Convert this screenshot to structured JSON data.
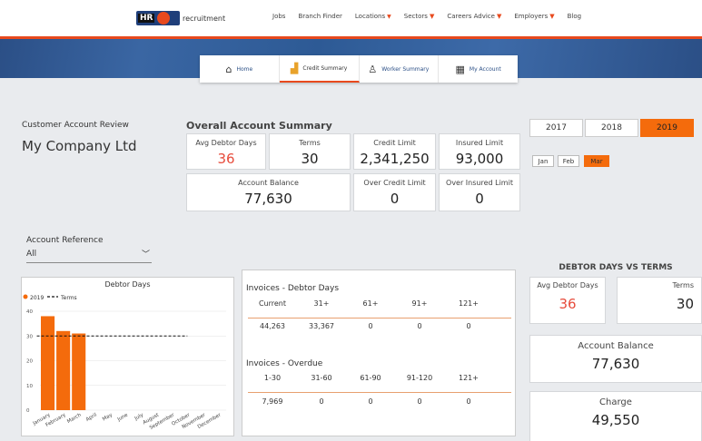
{
  "nav": {
    "logo_hr": "HR",
    "logo_text": "recruitment",
    "links": [
      {
        "label": "Jobs",
        "dropdown": false
      },
      {
        "label": "Branch Finder",
        "dropdown": false
      },
      {
        "label": "Locations",
        "dropdown": true
      },
      {
        "label": "Sectors",
        "dropdown": true
      },
      {
        "label": "Careers Advice",
        "dropdown": true
      },
      {
        "label": "Employers",
        "dropdown": true
      },
      {
        "label": "Blog",
        "dropdown": false
      }
    ],
    "dropdown_glyph": "▼"
  },
  "tabs": [
    {
      "label": "Home",
      "icon": "home-icon",
      "glyph": "⌂"
    },
    {
      "label": "Credit Summary",
      "icon": "chart-icon",
      "glyph": "▟"
    },
    {
      "label": "Worker Summary",
      "icon": "person-icon",
      "glyph": "♙"
    },
    {
      "label": "My Account",
      "icon": "calculator-icon",
      "glyph": "▦"
    }
  ],
  "customer": {
    "review_label": "Customer Account Review",
    "company": "My Company Ltd"
  },
  "summary": {
    "title": "Overall Account Summary",
    "avg_debtor_days": {
      "label": "Avg Debtor Days",
      "value": "36"
    },
    "terms": {
      "label": "Terms",
      "value": "30"
    },
    "credit_limit": {
      "label": "Credit Limit",
      "value": "2,341,250"
    },
    "insured_limit": {
      "label": "Insured Limit",
      "value": "93,000"
    },
    "account_balance": {
      "label": "Account Balance",
      "value": "77,630"
    },
    "over_credit_limit": {
      "label": "Over Credit Limit",
      "value": "0"
    },
    "over_insured_limit": {
      "label": "Over Insured Limit",
      "value": "0"
    }
  },
  "years": [
    "2017",
    "2018",
    "2019"
  ],
  "months": [
    "Jan",
    "Feb",
    "Mar"
  ],
  "account_reference": {
    "label": "Account Reference",
    "value": "All",
    "chevron": "﹀"
  },
  "debtor_chart_title": "Debtor Days",
  "debtor_vs_terms": {
    "title": "DEBTOR DAYS VS TERMS",
    "avg_label": "Avg Debtor Days",
    "avg_value": "36",
    "terms_label": "Terms",
    "terms_value": "30",
    "balance_label": "Account Balance",
    "balance_value": "77,630",
    "charge_label": "Charge",
    "charge_value": "49,550"
  },
  "invoices_debtor": {
    "title": "Invoices - Debtor Days",
    "headers": [
      "Current",
      "31+",
      "61+",
      "91+",
      "121+"
    ],
    "values": [
      "44,263",
      "33,367",
      "0",
      "0",
      "0"
    ]
  },
  "invoices_overdue": {
    "title": "Invoices - Overdue",
    "headers": [
      "1-30",
      "31-60",
      "61-90",
      "91-120",
      "121+"
    ],
    "values": [
      "7,969",
      "0",
      "0",
      "0",
      "0"
    ]
  },
  "colors": {
    "accent": "#f46b0c",
    "nav_blue": "#2b4f86",
    "red_value": "#e74c3c"
  },
  "chart_data": {
    "type": "bar",
    "title": "Debtor Days",
    "categories": [
      "January",
      "February",
      "March",
      "April",
      "May",
      "June",
      "July",
      "August",
      "September",
      "October",
      "November",
      "December"
    ],
    "series": [
      {
        "name": "2019",
        "kind": "bar",
        "color": "#f46b0c",
        "values": [
          38,
          32,
          31,
          null,
          null,
          null,
          null,
          null,
          null,
          null,
          null,
          null
        ]
      },
      {
        "name": "Terms",
        "kind": "line",
        "style": "dashed",
        "color": "#111111",
        "values": [
          30,
          30,
          30,
          30,
          30,
          30,
          30,
          30,
          30,
          30,
          30,
          30
        ]
      }
    ],
    "yticks": [
      0,
      10,
      20,
      30,
      40
    ],
    "ylim": [
      0,
      40
    ],
    "grid": true,
    "legend": "top-left"
  }
}
